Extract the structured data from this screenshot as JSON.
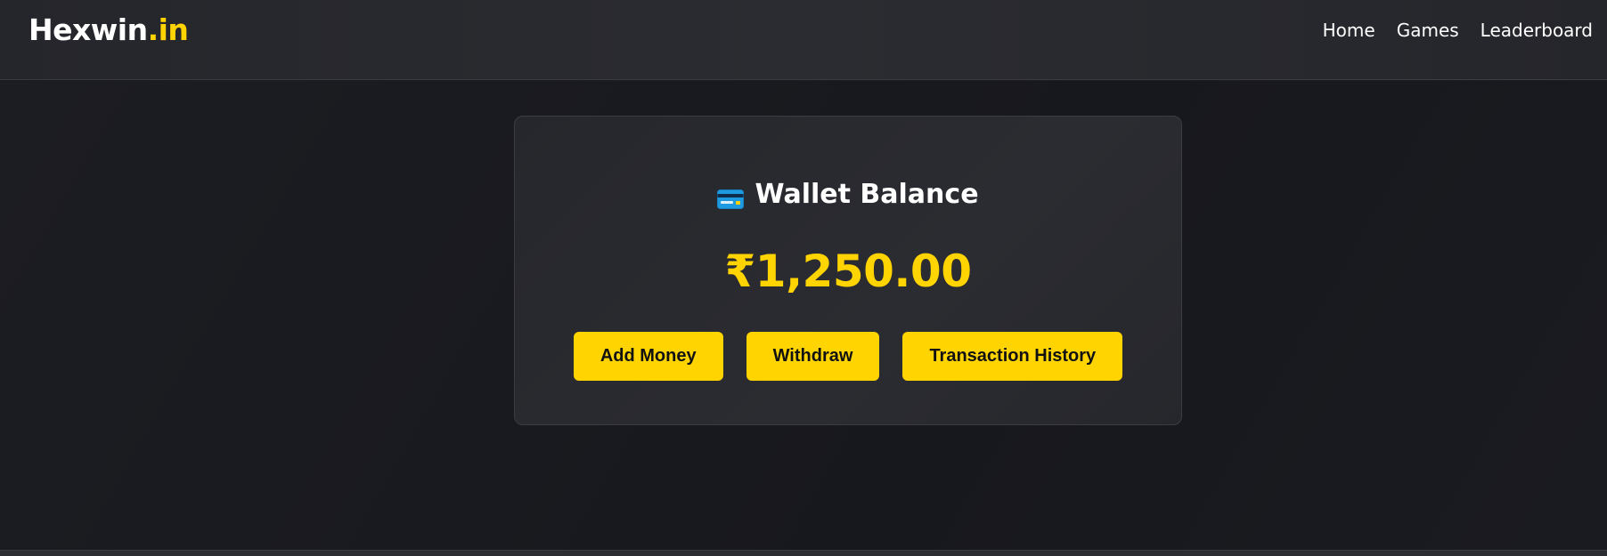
{
  "header": {
    "logo_main": "Hexwin",
    "logo_accent": ".in",
    "nav": [
      "Home",
      "Games",
      "Leaderboard"
    ]
  },
  "wallet": {
    "icon": "credit-card-icon",
    "title": "Wallet Balance",
    "balance": "₹1,250.00",
    "buttons": {
      "add_money": "Add Money",
      "withdraw": "Withdraw",
      "history": "Transaction History"
    }
  },
  "colors": {
    "accent": "#ffd400",
    "background": "#1b1c21",
    "card": "#2a2b30",
    "text": "#ffffff"
  }
}
